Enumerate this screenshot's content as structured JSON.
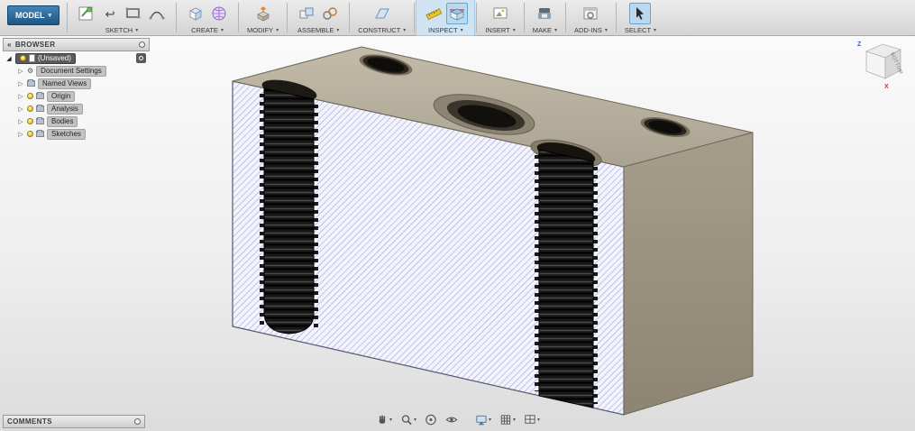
{
  "icons": {
    "chevron_down": "▾",
    "expander_open": "◢",
    "expander_closed": "▷",
    "gear": "⚙",
    "undo_arrow": "↩",
    "collapse_left": "«"
  },
  "toolbar": {
    "model_button": "MODEL",
    "groups": [
      {
        "label": "SKETCH"
      },
      {
        "label": "CREATE"
      },
      {
        "label": "MODIFY"
      },
      {
        "label": "ASSEMBLE"
      },
      {
        "label": "CONSTRUCT"
      },
      {
        "label": "INSPECT"
      },
      {
        "label": "INSERT"
      },
      {
        "label": "MAKE"
      },
      {
        "label": "ADD-INS"
      },
      {
        "label": "SELECT"
      }
    ]
  },
  "browser": {
    "title": "BROWSER",
    "root_label": "(Unsaved)",
    "items": [
      {
        "label": "Document Settings"
      },
      {
        "label": "Named Views"
      },
      {
        "label": "Origin"
      },
      {
        "label": "Analysis"
      },
      {
        "label": "Bodies"
      },
      {
        "label": "Sketches"
      }
    ]
  },
  "comments": {
    "title": "COMMENTS"
  },
  "viewcube": {
    "face_label": "BOTTOM",
    "axis_x": "X",
    "axis_z": "Z"
  },
  "model": {
    "top_face_color": "#b9b19e",
    "side_face_color": "#9c9480",
    "hatch_line_color": "#959bd8",
    "hatch_bg_color": "#f3f4fb",
    "thread_color": "#171717"
  }
}
